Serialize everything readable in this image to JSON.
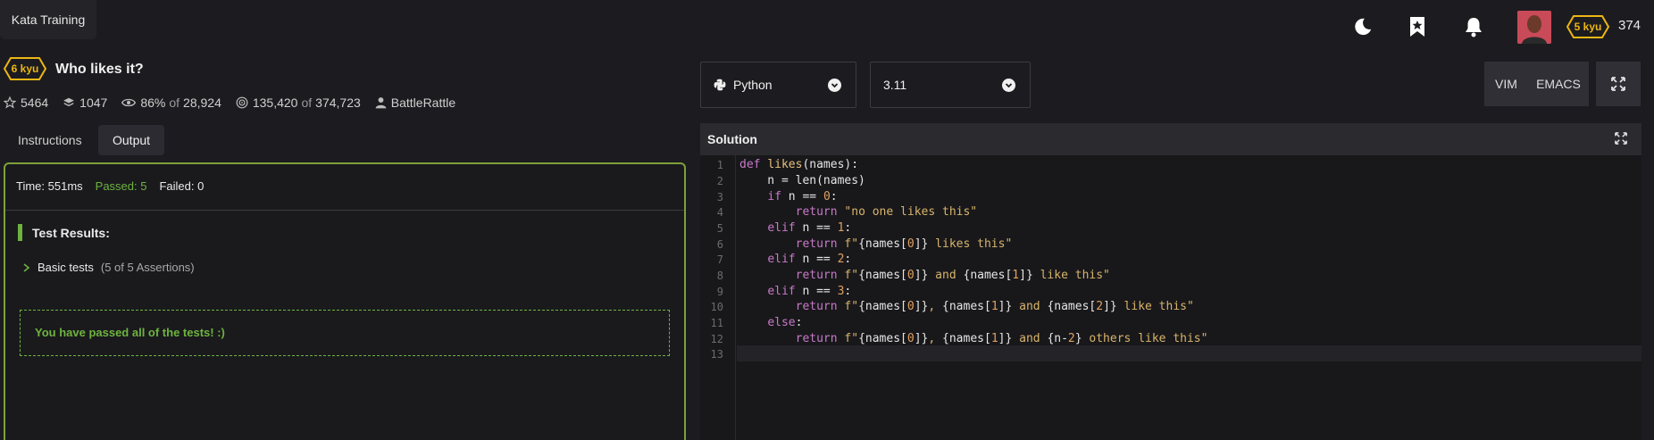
{
  "topbar": {
    "brand": "Kata Training",
    "user_rank": "5 kyu",
    "honor": "374",
    "icons": [
      "moon-icon",
      "bookmark-star-icon",
      "bell-icon"
    ],
    "accent_color": "#ecb613"
  },
  "kata": {
    "rank": "6 kyu",
    "title": "Who likes it?",
    "stars": "5464",
    "collections": "1047",
    "satisfaction_pct": "86%",
    "satisfaction_of": "of",
    "satisfaction_votes": "28,924",
    "completed": "135,420",
    "completed_of": "of",
    "attempts": "374,723",
    "author": "BattleRattle"
  },
  "tabs": [
    {
      "label": "Instructions",
      "active": false
    },
    {
      "label": "Output",
      "active": true
    }
  ],
  "output": {
    "time": "Time: 551ms",
    "passed": "Passed: 5",
    "failed": "Failed: 0",
    "test_results_label": "Test Results:",
    "group_label": "Basic tests",
    "group_detail": "(5 of 5 Assertions)",
    "pass_message": "You have passed all of the tests! :)",
    "pass_color": "#6eb33f"
  },
  "editor": {
    "language": "Python",
    "version": "3.11",
    "vim_label": "VIM",
    "emacs_label": "EMACS",
    "panel_title": "Solution",
    "line_numbers": [
      "1",
      "2",
      "3",
      "4",
      "5",
      "6",
      "7",
      "8",
      "9",
      "10",
      "11",
      "12",
      "13"
    ]
  }
}
